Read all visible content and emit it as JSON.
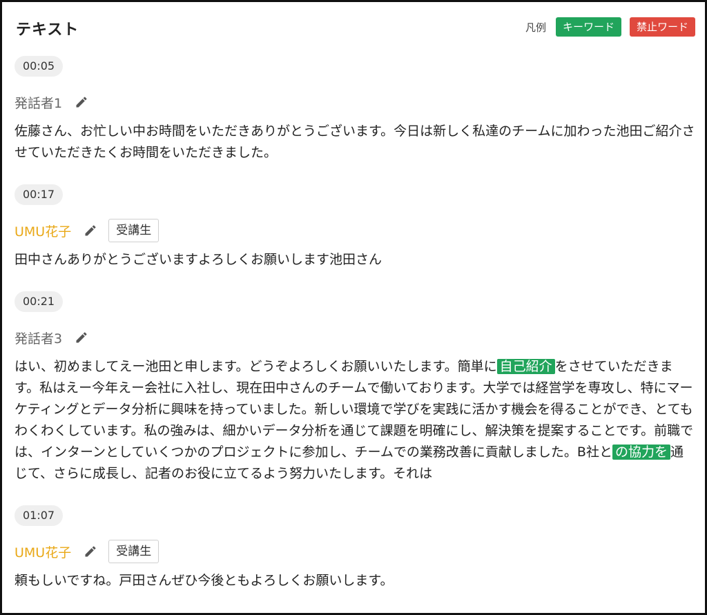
{
  "header": {
    "title": "テキスト",
    "legend_label": "凡例",
    "keyword_label": "キーワード",
    "banned_label": "禁止ワード"
  },
  "colors": {
    "keyword": "#21a45b",
    "banned": "#e0493e",
    "speaker_highlight": "#e9a817"
  },
  "icons": {
    "edit": "pencil-icon"
  },
  "entries": [
    {
      "time": "00:05",
      "speaker": "発話者1",
      "text": "佐藤さん、お忙しい中お時間をいただきありがとうございます。今日は新しく私達のチームに加わった池田ご紹介させていただきたくお時間をいただきました。"
    },
    {
      "time": "00:17",
      "speaker": "UMU花子",
      "role": "受講生",
      "text": "田中さんありがとうございますよろしくお願いします池田さん"
    },
    {
      "time": "00:21",
      "speaker": "発話者3",
      "text_parts": [
        "はい、初めましてえー池田と申します。どうぞよろしくお願いいたします。簡単に",
        "自己紹介",
        "をさせていただきます。私はえー今年えー会社に入社し、現在田中さんのチームで働いております。大学では経営学を専攻し、特にマーケティングとデータ分析に興味を持っていました。新しい環境で学びを実践に活かす機会を得ることができ、とてもわくわくしています。私の強みは、細かいデータ分析を通じて課題を明確にし、解決策を提案することです。前職では、インターンとしていくつかのプロジェクトに参加し、チームでの業務改善に貢献しました。B社と",
        "の協力を",
        "通じて、さらに成長し、記者のお役に立てるよう努力いたします。それは"
      ]
    },
    {
      "time": "01:07",
      "speaker": "UMU花子",
      "role": "受講生",
      "text": "頼もしいですね。戸田さんぜひ今後ともよろしくお願いします。"
    }
  ]
}
